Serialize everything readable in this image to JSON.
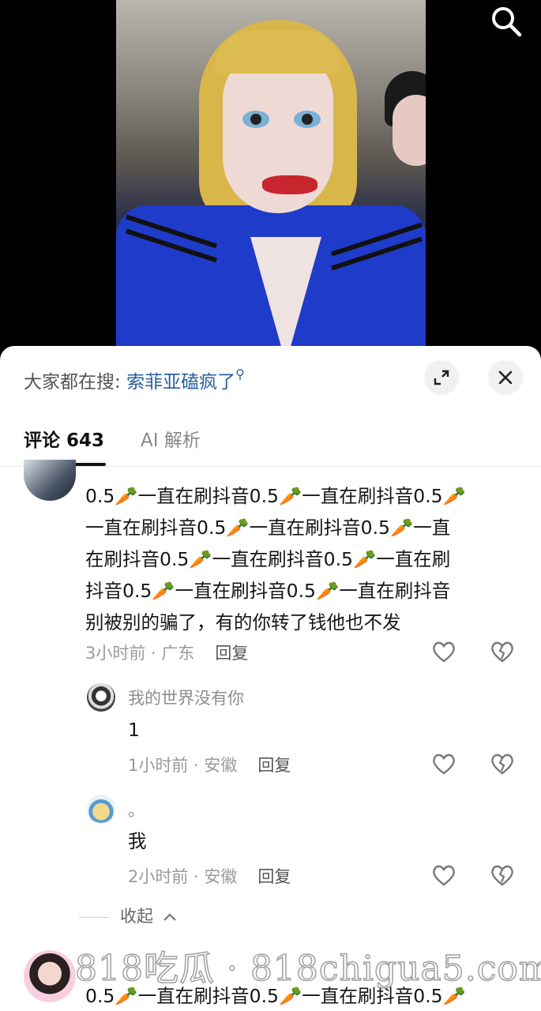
{
  "hot_search": {
    "label": "大家都在搜:",
    "term": "索菲亚磕疯了"
  },
  "tabs": {
    "comments": "评论 643",
    "ai": "AI 解析"
  },
  "comments": [
    {
      "lines": [
        "0.5🥕一直在刷抖音0.5🥕一直在刷抖音0.5🥕",
        "一直在刷抖音0.5🥕一直在刷抖音0.5🥕一直",
        "在刷抖音0.5🥕一直在刷抖音0.5🥕一直在刷",
        "抖音0.5🥕一直在刷抖音0.5🥕一直在刷抖音",
        "别被别的骗了，有的你转了钱他也不发"
      ],
      "time": "3小时前 · 广东",
      "reply": "回复"
    }
  ],
  "replies": [
    {
      "username": "我的世界没有你",
      "text": "1",
      "time": "1小时前 · 安徽",
      "reply": "回复"
    },
    {
      "username": "。",
      "text": "我",
      "time": "2小时前 · 安徽",
      "reply": "回复"
    }
  ],
  "collapse_label": "收起",
  "next_comment": {
    "text": "0.5🥕一直在刷抖音0.5🥕一直在刷抖音0.5🥕"
  },
  "watermark": "818吃瓜 · 818chigua5.com",
  "colors": {
    "link": "#2a5fa3",
    "jacket": "#1f3bc9",
    "hair": "#d8b64a"
  },
  "icons": [
    "search-icon",
    "expand-icon",
    "close-icon",
    "heart-icon",
    "broken-heart-icon",
    "chevron-up-icon",
    "search-small-icon"
  ]
}
